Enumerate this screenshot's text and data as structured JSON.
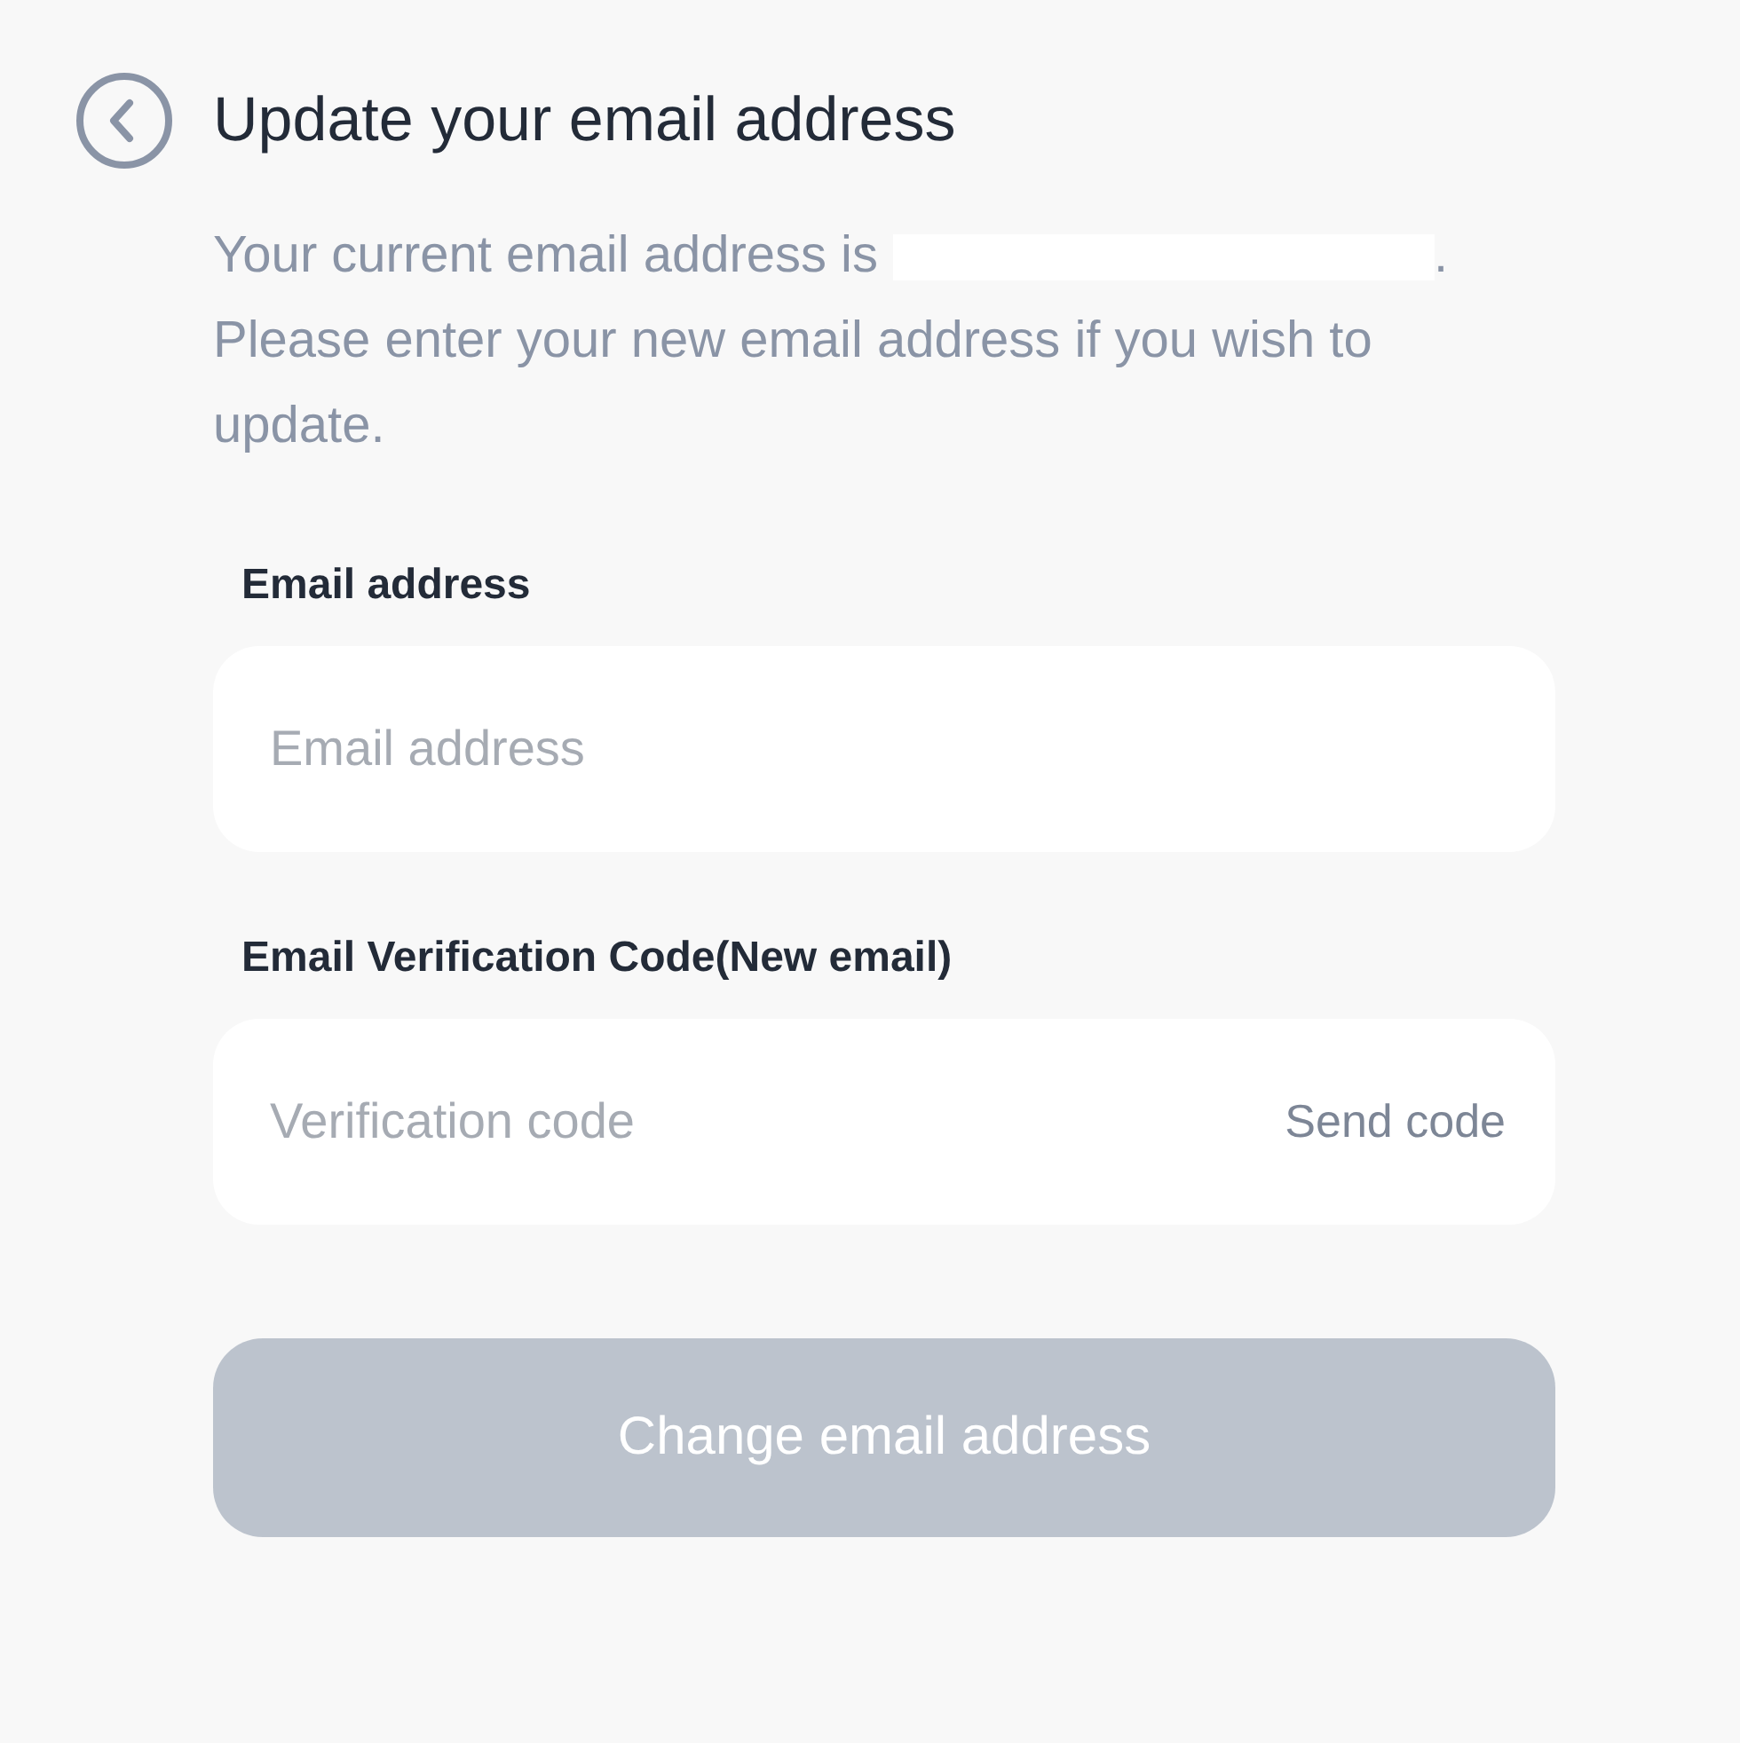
{
  "header": {
    "title": "Update your email address"
  },
  "description": {
    "text_before": "Your current email address is",
    "redacted": true,
    "text_after": ". Please enter your new email address if you wish to update."
  },
  "fields": [
    {
      "label": "Email address",
      "placeholder": "Email address"
    },
    {
      "label": "Email Verification Code(New email)",
      "placeholder": "Verification code",
      "action": "Send code"
    }
  ],
  "submit": {
    "label": "Change email address",
    "disabled": true
  }
}
